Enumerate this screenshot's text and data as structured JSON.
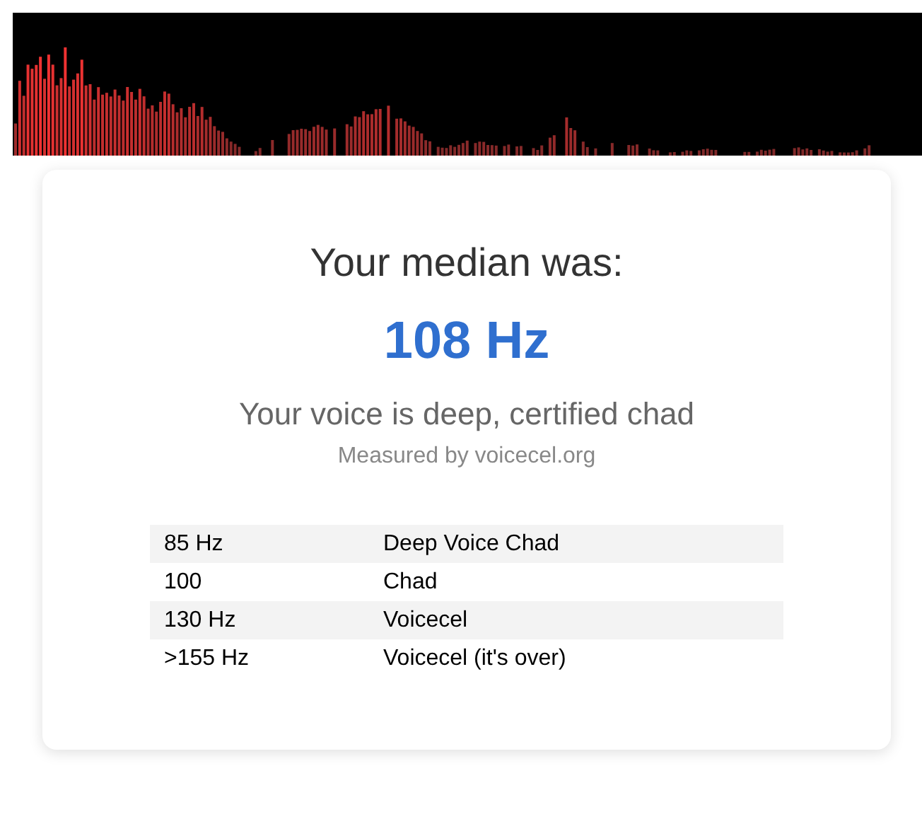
{
  "result": {
    "heading": "Your median was:",
    "value": "108 Hz",
    "verdict": "Your voice is deep, certified chad",
    "credit": "Measured by voicecel.org"
  },
  "table": {
    "rows": [
      {
        "frequency": "85 Hz",
        "label": "Deep Voice Chad"
      },
      {
        "frequency": "100",
        "label": "Chad"
      },
      {
        "frequency": "130 Hz",
        "label": "Voicecel"
      },
      {
        "frequency": ">155 Hz",
        "label": "Voicecel (it's over)"
      }
    ]
  }
}
